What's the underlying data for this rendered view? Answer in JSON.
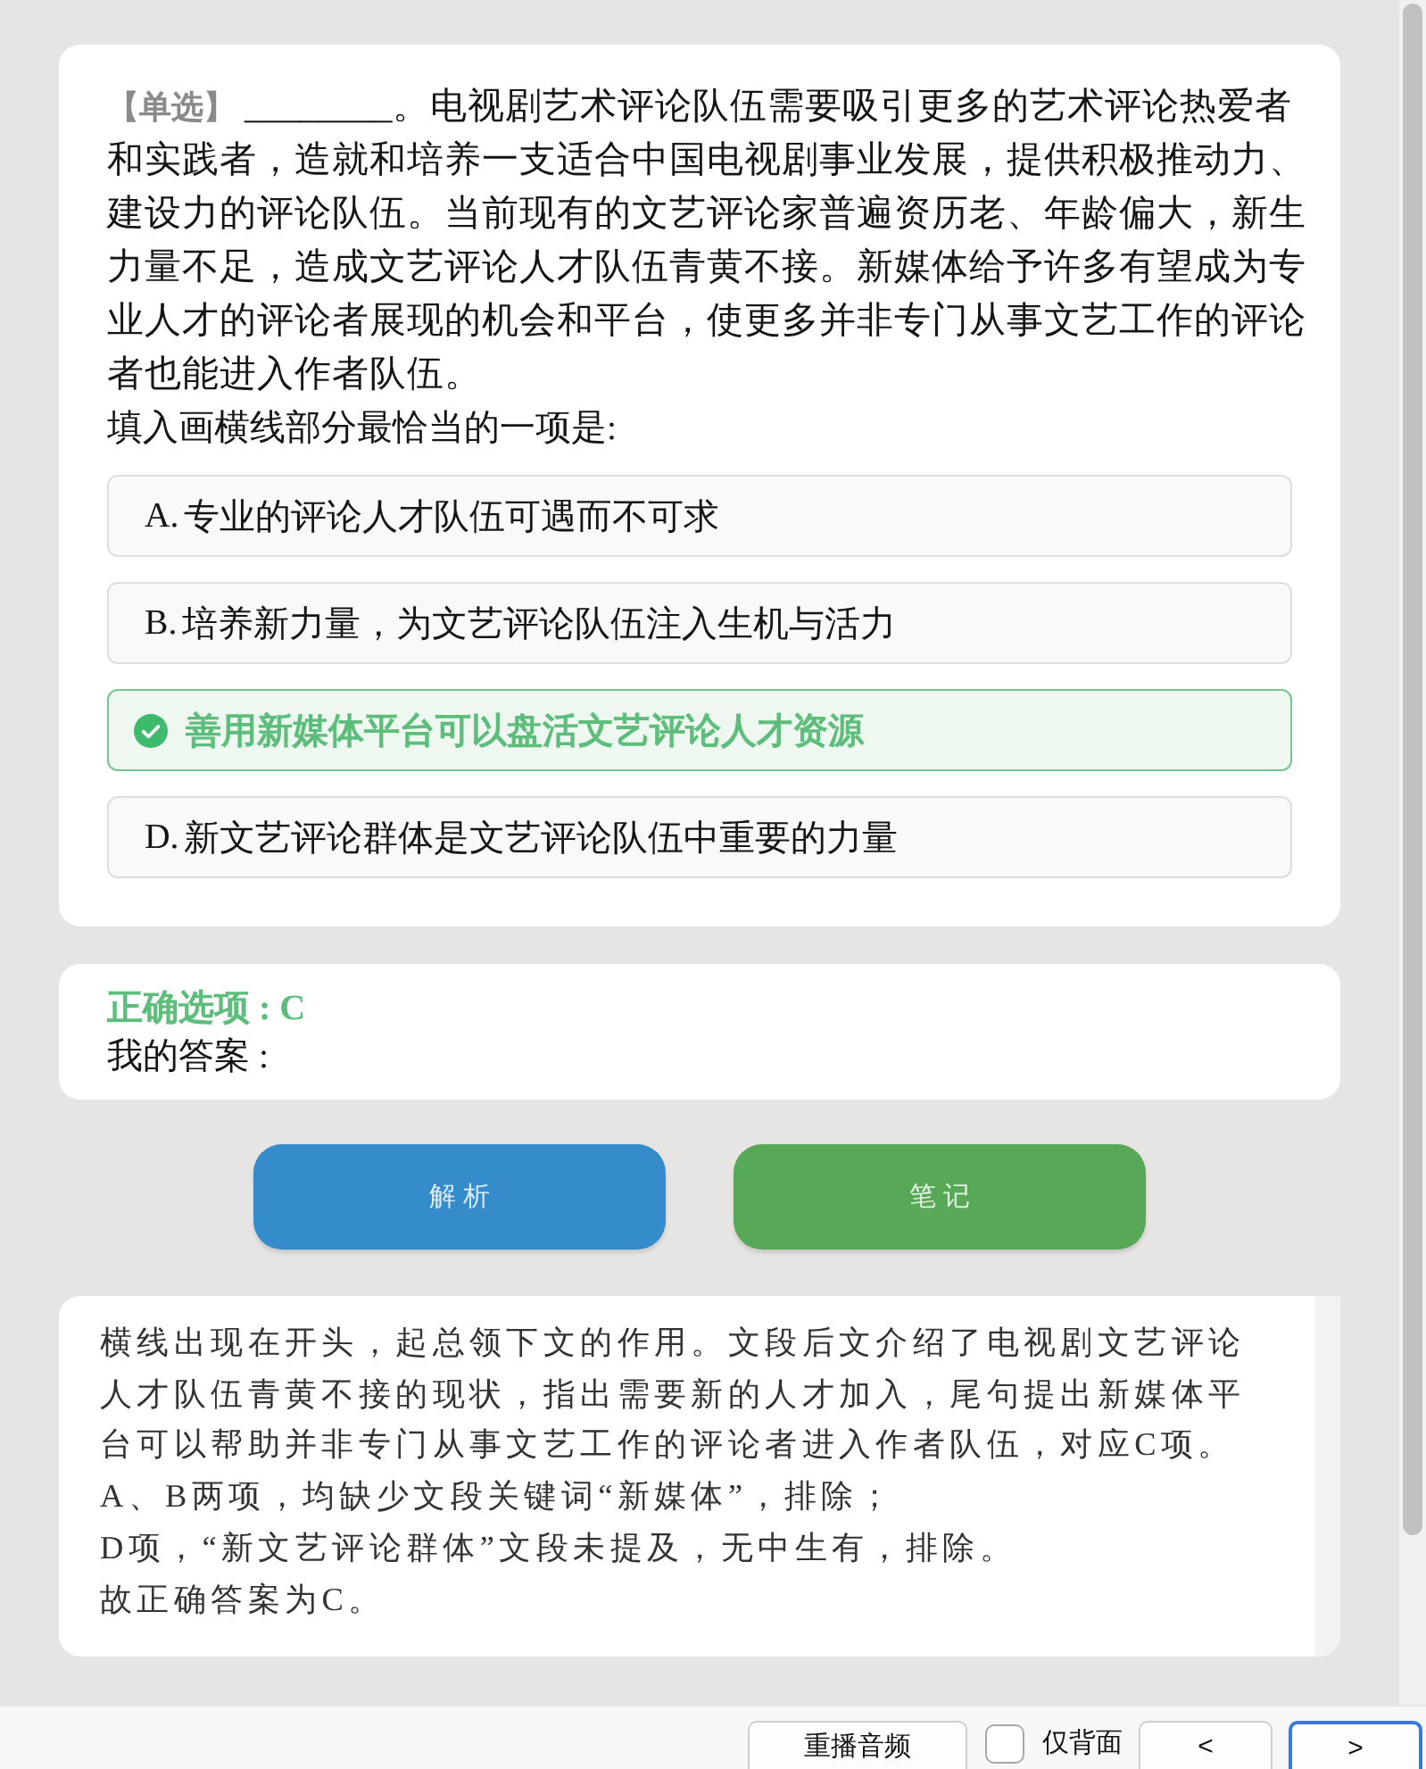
{
  "question": {
    "type_tag": "【单选】",
    "text": "________。电视剧艺术评论队伍需要吸引更多的艺术评论热爱者和实践者，造就和培养一支适合中国电视剧事业发展，提供积极推动力、建设力的评论队伍。当前现有的文艺评论家普遍资历老、年龄偏大，新生力量不足，造成文艺评论人才队伍青黄不接。新媒体给予许多有望成为专业人才的评论者展现的机会和平台，使更多并非专门从事文艺工作的评论者也能进入作者队伍。",
    "prompt": "填入画横线部分最恰当的一项是:"
  },
  "options": [
    {
      "label": "A.",
      "text": "专业的评论人才队伍可遇而不可求",
      "correct": false
    },
    {
      "label": "B.",
      "text": "培养新力量，为文艺评论队伍注入生机与活力",
      "correct": false
    },
    {
      "text": "善用新媒体平台可以盘活文艺评论人才资源",
      "correct": true
    },
    {
      "label": "D.",
      "text": "新文艺评论群体是文艺评论队伍中重要的力量",
      "correct": false
    }
  ],
  "answer": {
    "correct_option": "正确选项 : C",
    "my_answer": "我的答案 :"
  },
  "buttons": [
    {
      "label": "解析",
      "kind": "analysis"
    },
    {
      "label": "笔记",
      "kind": "notes"
    }
  ],
  "explanation": {
    "paragraphs": [
      "横线出现在开头，起总领下文的作用。文段后文介绍了电视剧文艺评论人才队伍青黄不接的现状，指出需要新的人才加入，尾句提出新媒体平台可以帮助并非专门从事文艺工作的评论者进入作者队伍，对应C项。",
      "A、B两项，均缺少文段关键词“新媒体”，排除；",
      "D项，“新文艺评论群体”文段未提及，无中生有，排除。",
      "故正确答案为C。"
    ]
  },
  "bottom_bar": {
    "replay_button": "重播音频",
    "back_only": {
      "label": "仅背面",
      "checked": false
    },
    "nav_buttons": [
      {
        "label": "<",
        "focused": false
      },
      {
        "label": ">",
        "focused": true
      }
    ]
  }
}
